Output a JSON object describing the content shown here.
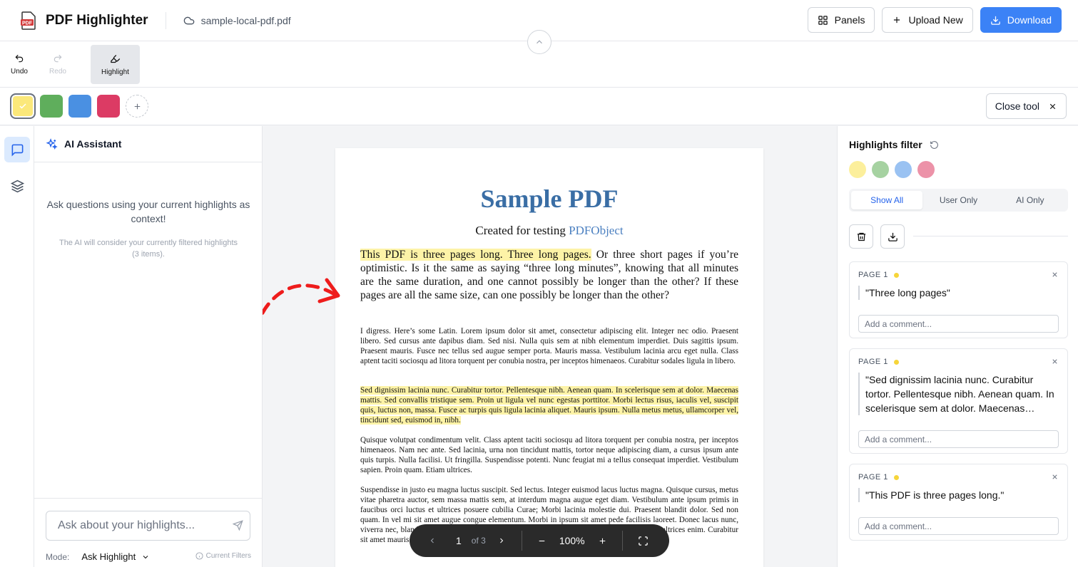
{
  "header": {
    "app_title": "PDF Highlighter",
    "file_name": "sample-local-pdf.pdf",
    "panels_label": "Panels",
    "upload_label": "Upload New",
    "download_label": "Download"
  },
  "toolbar": {
    "undo_label": "Undo",
    "redo_label": "Redo",
    "highlight_label": "Highlight"
  },
  "colors": {
    "swatches": [
      "#fbe87a",
      "#5fae5c",
      "#4a90e2",
      "#dc3b64"
    ],
    "selected_index": 0,
    "filter_dots": [
      "#fcef9c",
      "#a6d2a1",
      "#9ac2f2",
      "#ec92a8"
    ]
  },
  "close_tool_label": "Close tool",
  "ai": {
    "title": "AI Assistant",
    "description": "Ask questions using your current highlights as context!",
    "note": "The AI will consider your currently filtered highlights (3 items).",
    "input_placeholder": "Ask about your highlights...",
    "mode_label": "Mode:",
    "mode_value": "Ask Highlight",
    "filters_label": "Current Filters"
  },
  "pdf": {
    "title": "Sample PDF",
    "subtitle_prefix": "Created for testing",
    "subtitle_link": "PDFObject",
    "lead_highlight": "This PDF is three pages long. Three long pages.",
    "lead_rest": " Or three short pages if you’re optimistic. Is it the same as saying “three long minutes”, knowing that all minutes are the same duration, and one cannot possibly be longer than the other? If these pages are all the same size, can one possibly be longer than the other?",
    "para1": "I digress. Here’s some Latin. Lorem ipsum dolor sit amet, consectetur adipiscing elit. Integer nec odio. Praesent libero. Sed cursus ante dapibus diam. Sed nisi. Nulla quis sem at nibh elementum imperdiet. Duis sagittis ipsum. Praesent mauris. Fusce nec tellus sed augue semper porta. Mauris massa. Vestibulum lacinia arcu eget nulla. Class aptent taciti sociosqu ad litora torquent per conubia nostra, per inceptos himenaeos. Curabitur sodales ligula in libero.",
    "para2": "Sed dignissim lacinia nunc. Curabitur tortor. Pellentesque nibh. Aenean quam. In scelerisque sem at dolor. Maecenas mattis. Sed convallis tristique sem. Proin ut ligula vel nunc egestas porttitor. Morbi lectus risus, iaculis vel, suscipit quis, luctus non, massa. Fusce ac turpis quis ligula lacinia aliquet. Mauris ipsum. Nulla metus metus, ullamcorper vel, tincidunt sed, euismod in, nibh.",
    "para3": "Quisque volutpat condimentum velit. Class aptent taciti sociosqu ad litora torquent per conubia nostra, per inceptos himenaeos. Nam nec ante. Sed lacinia, urna non tincidunt mattis, tortor neque adipiscing diam, a cursus ipsum ante quis turpis. Nulla facilisi. Ut fringilla. Suspendisse potenti. Nunc feugiat mi a tellus consequat imperdiet. Vestibulum sapien. Proin quam. Etiam ultrices.",
    "para4": "Suspendisse in justo eu magna luctus suscipit. Sed lectus. Integer euismod lacus luctus magna. Quisque cursus, metus vitae pharetra auctor, sem massa mattis sem, at interdum magna augue eget diam. Vestibulum ante ipsum primis in faucibus orci luctus et ultrices posuere cubilia Curae; Morbi lacinia molestie dui. Praesent blandit dolor. Sed non quam. In vel mi sit amet augue congue elementum. Morbi in ipsum sit amet pede facilisis laoreet. Donec lacus nunc, viverra nec, blandit vel, egestas et, augue. Vestibulum tincidunt malesuada tellus. Ut ultrices ultrices enim. Curabitur sit amet mauris."
  },
  "pager": {
    "page": "1",
    "of_label": "of 3",
    "zoom": "100%"
  },
  "filters": {
    "title": "Highlights filter",
    "tabs": [
      "Show All",
      "User Only",
      "AI Only"
    ],
    "active_tab": 0
  },
  "highlights": [
    {
      "page_label": "PAGE 1",
      "quote": "\"Three long pages\"",
      "comment_placeholder": "Add a comment..."
    },
    {
      "page_label": "PAGE 1",
      "quote": "\"Sed dignissim lacinia nunc. Curabitur tortor. Pellentesque nibh. Aenean quam. In scelerisque sem at dolor. Maecenas…",
      "comment_placeholder": "Add a comment..."
    },
    {
      "page_label": "PAGE 1",
      "quote": "\"This PDF is three pages long.\"",
      "comment_placeholder": "Add a comment..."
    }
  ]
}
